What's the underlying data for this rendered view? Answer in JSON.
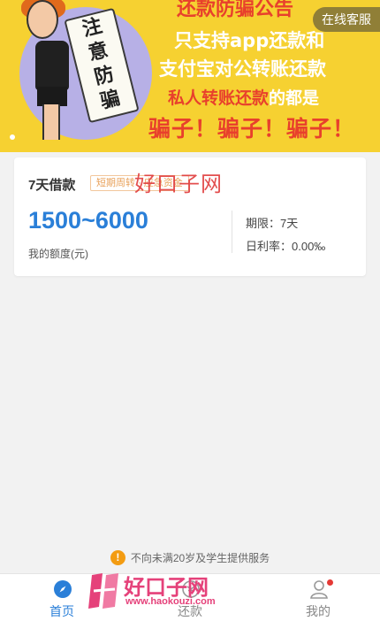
{
  "banner": {
    "title": "还款防骗公告",
    "line1": "只支持app还款和",
    "line2": "支付宝对公转账还款",
    "line3_prefix": "私人转账还款",
    "line3_suffix": "的都是",
    "line4": "骗子！骗子！骗子！",
    "scroll_chars": [
      "注",
      "意",
      "防",
      "骗"
    ],
    "service_button": "在线客服"
  },
  "loan_card": {
    "title": "7天借款",
    "tag": "短期周转 · 应急资金",
    "amount": "1500~6000",
    "amount_label": "我的额度(元)",
    "term": "期限：7天",
    "daily_rate": "日利率：0.00‰",
    "watermark": "好口子网"
  },
  "notice": {
    "text": "不向未满20岁及学生提供服务",
    "icon": "warning-icon"
  },
  "tabbar": {
    "tabs": [
      {
        "label": "首页",
        "icon": "compass-icon",
        "active": true
      },
      {
        "label": "还款",
        "icon": "repay-icon",
        "active": false
      },
      {
        "label": "我的",
        "icon": "user-icon",
        "active": false
      }
    ]
  },
  "watermark_logo": {
    "brand": "好口子网",
    "url": "www.haokouzi.com"
  },
  "colors": {
    "accent": "#2a7fd8",
    "banner_bg": "#f6d131",
    "alert_red": "#e8402c"
  }
}
